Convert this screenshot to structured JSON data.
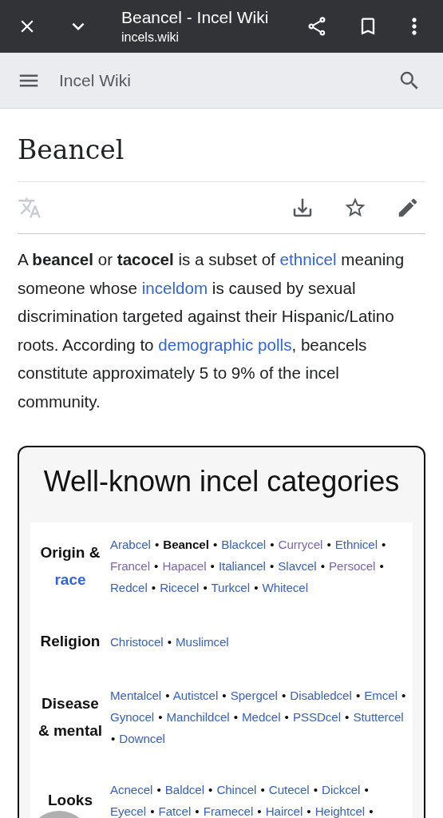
{
  "browser_bar": {
    "title": "Beancel - Incel Wiki",
    "url": "incels.wiki"
  },
  "site_header": {
    "name": "Incel Wiki"
  },
  "page_title": "Beancel",
  "intro": [
    {
      "text": "A "
    },
    {
      "text": "beancel",
      "kind": "bold"
    },
    {
      "text": " or "
    },
    {
      "text": "tacocel",
      "kind": "bold"
    },
    {
      "text": " is a subset of "
    },
    {
      "text": "ethnicel",
      "kind": "link"
    },
    {
      "text": " meaning someone whose "
    },
    {
      "text": "inceldom",
      "kind": "link"
    },
    {
      "text": " is caused by sexual discrimination targeted against their Hispanic/Latino roots. According to "
    },
    {
      "text": "demographic polls",
      "kind": "link"
    },
    {
      "text": ", beancels constitute approximately 5 to 9% of the incel community."
    }
  ],
  "navbox": {
    "title": "Well-known incel categories",
    "rows": [
      {
        "label": [
          {
            "text": "Origin &",
            "kind": "plain"
          },
          {
            "text": "race",
            "kind": "link"
          }
        ],
        "items": [
          {
            "text": "Arabcel",
            "kind": "link",
            "sep": "•"
          },
          {
            "text": "Beancel",
            "kind": "current",
            "sep": "•"
          },
          {
            "text": "Blackcel",
            "kind": "link",
            "sep": "•"
          },
          {
            "text": "Currycel",
            "kind": "visited",
            "sep": "•"
          },
          {
            "text": "Ethnicel",
            "kind": "link",
            "sep": "•"
          },
          {
            "text": "Francel",
            "kind": "visited",
            "sep": "•"
          },
          {
            "text": "Hapacel",
            "kind": "visited",
            "sep": "•"
          },
          {
            "text": "Italiancel",
            "kind": "link",
            "sep": "•"
          },
          {
            "text": "Slavcel",
            "kind": "link",
            "sep": "•"
          },
          {
            "text": "Persocel",
            "kind": "visited",
            "sep": "•"
          },
          {
            "text": "Redcel",
            "kind": "link",
            "sep": "•"
          },
          {
            "text": "Ricecel",
            "kind": "link",
            "sep": "•"
          },
          {
            "text": "Turkcel",
            "kind": "link",
            "sep": "•"
          },
          {
            "text": "Whitecel",
            "kind": "link"
          }
        ]
      },
      {
        "label": [
          {
            "text": "Religion",
            "kind": "plain"
          }
        ],
        "items": [
          {
            "text": "Christocel",
            "kind": "link",
            "sep": "•"
          },
          {
            "text": "Muslimcel",
            "kind": "link"
          }
        ]
      },
      {
        "label": [
          {
            "text": "Disease",
            "kind": "plain"
          },
          {
            "text": "& mental",
            "kind": "plain"
          }
        ],
        "items": [
          {
            "text": "Mentalcel",
            "kind": "link",
            "sep": "•"
          },
          {
            "text": "Autistcel",
            "kind": "link",
            "sep": "•"
          },
          {
            "text": "Spergcel",
            "kind": "link",
            "sep": "•"
          },
          {
            "text": "Disabledcel",
            "kind": "link",
            "sep": "•"
          },
          {
            "text": "Emcel",
            "kind": "link",
            "sep": "•"
          },
          {
            "text": "Gynocel",
            "kind": "link",
            "sep": "•"
          },
          {
            "text": "Manchildcel",
            "kind": "link",
            "sep": "•"
          },
          {
            "text": "Medcel",
            "kind": "link",
            "sep": "•"
          },
          {
            "text": "PSSDcel",
            "kind": "link",
            "sep": "•"
          },
          {
            "text": "Stuttercel",
            "kind": "link",
            "sep": "•"
          },
          {
            "text": "Downcel",
            "kind": "link"
          }
        ]
      },
      {
        "label": [
          {
            "text": "Looks",
            "kind": "plain"
          }
        ],
        "items": [
          {
            "text": "Acnecel",
            "kind": "link",
            "sep": "•"
          },
          {
            "text": "Baldcel",
            "kind": "link",
            "sep": "•"
          },
          {
            "text": "Chincel",
            "kind": "link",
            "sep": "•"
          },
          {
            "text": "Cutecel",
            "kind": "link",
            "sep": "•"
          },
          {
            "text": "Dickcel",
            "kind": "link",
            "sep": "•"
          },
          {
            "text": "Eyecel",
            "kind": "link",
            "sep": "•"
          },
          {
            "text": "Fatcel",
            "kind": "link",
            "sep": "•"
          },
          {
            "text": "Framecel",
            "kind": "link",
            "sep": "•"
          },
          {
            "text": "Haircel",
            "kind": "link",
            "sep": "•"
          },
          {
            "text": "Heightcel",
            "kind": "link",
            "sep": "•"
          }
        ]
      }
    ]
  }
}
